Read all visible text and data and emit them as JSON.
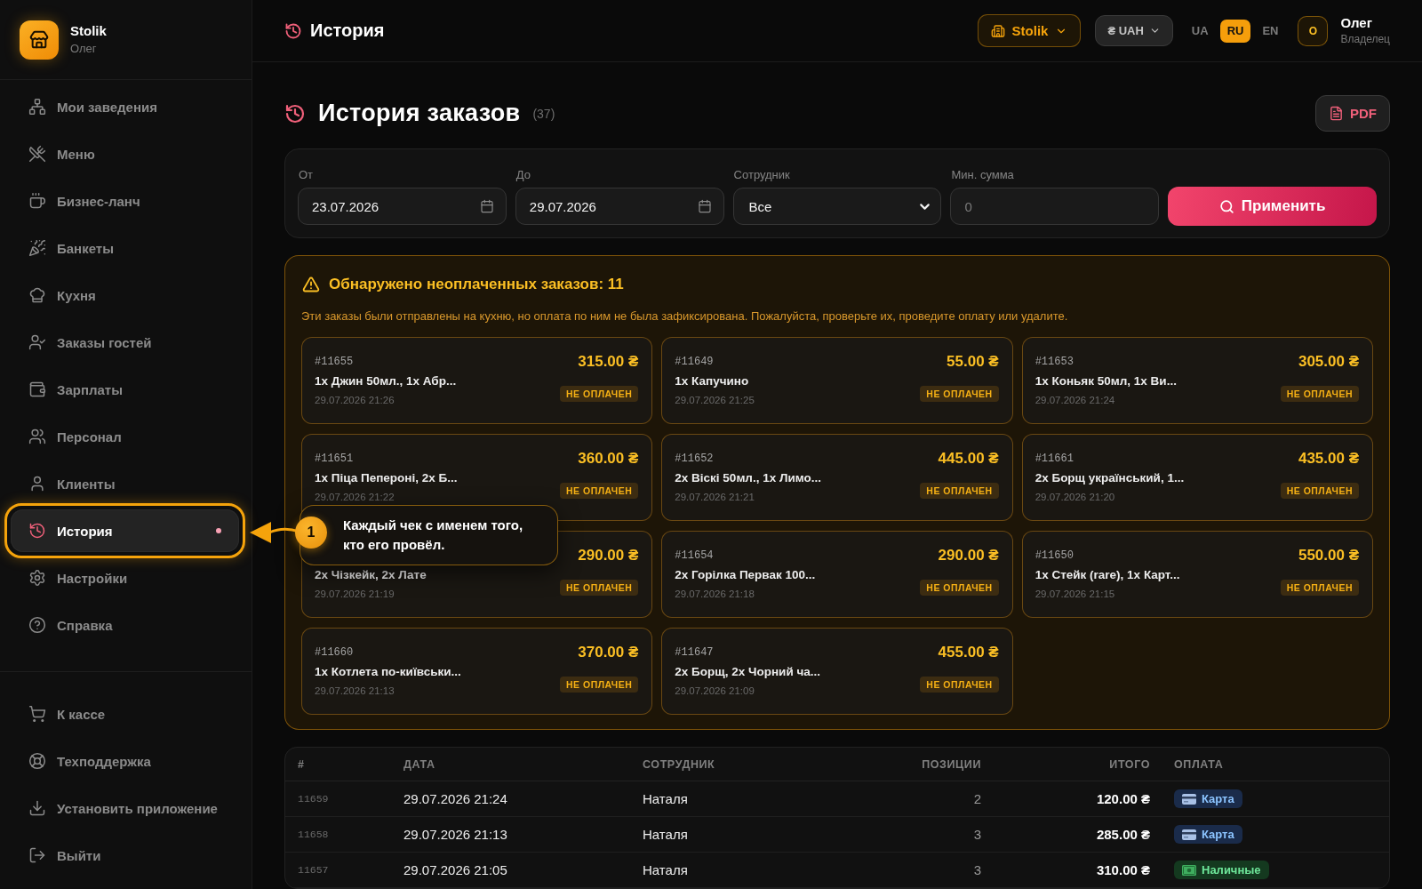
{
  "sidebar": {
    "brand": {
      "name": "Stolik",
      "subtitle": "Олег"
    },
    "nav": [
      {
        "label": "Мои заведения",
        "selected": false,
        "highlighted": false
      },
      {
        "label": "Меню",
        "selected": false,
        "highlighted": false
      },
      {
        "label": "Бизнес-ланч",
        "selected": false,
        "highlighted": false
      },
      {
        "label": "Банкеты",
        "selected": false,
        "highlighted": false
      },
      {
        "label": "Кухня",
        "selected": false,
        "highlighted": false
      },
      {
        "label": "Заказы гостей",
        "selected": false,
        "highlighted": false
      },
      {
        "label": "Зарплаты",
        "selected": false,
        "highlighted": false
      },
      {
        "label": "Персонал",
        "selected": false,
        "highlighted": false
      },
      {
        "label": "Клиенты",
        "selected": false,
        "highlighted": false
      },
      {
        "label": "История",
        "selected": true,
        "highlighted": true
      },
      {
        "label": "Настройки",
        "selected": false,
        "highlighted": false
      },
      {
        "label": "Справка",
        "selected": false,
        "highlighted": false
      }
    ],
    "footer_nav": [
      {
        "label": "К кассе",
        "selected": false
      },
      {
        "label": "Техподдержка",
        "selected": false
      },
      {
        "label": "Установить приложение",
        "selected": false
      },
      {
        "label": "Выйти",
        "selected": false
      }
    ]
  },
  "topbar": {
    "title": "История",
    "venue": "Stolik",
    "currency": "₴ UAH",
    "languages": [
      {
        "label": "UA",
        "selected": false
      },
      {
        "label": "RU",
        "selected": true
      },
      {
        "label": "EN",
        "selected": false
      }
    ],
    "user": {
      "initial": "О",
      "name": "Олег",
      "role": "Владелец"
    }
  },
  "page": {
    "title": "История заказов",
    "count": "(37)",
    "export_button": "PDF"
  },
  "filters": {
    "from": {
      "label": "От",
      "value": "23.07.2026"
    },
    "to": {
      "label": "До",
      "value": "29.07.2026"
    },
    "employee": {
      "label": "Сотрудник",
      "value": "Все"
    },
    "min_sum": {
      "label": "Мин. сумма",
      "placeholder": "0"
    },
    "apply_button": "Применить"
  },
  "unpaid_alert": {
    "title": "Обнаружено неоплаченных заказов: 11",
    "description": "Эти заказы были отправлены на кухню, но оплата по ним не была зафиксирована. Пожалуйста, проверьте их, проведите оплату или удалите.",
    "orders": [
      {
        "id": "#11655",
        "items": "1x Джин 50мл., 1x Абр...",
        "date": "29.07.2026 21:26",
        "amount": "315.00 ₴",
        "status": "НЕ ОПЛАЧЕН"
      },
      {
        "id": "#11649",
        "items": "1x Капучино",
        "date": "29.07.2026 21:25",
        "amount": "55.00 ₴",
        "status": "НЕ ОПЛАЧЕН"
      },
      {
        "id": "#11653",
        "items": "1x Коньяк 50мл, 1x Ви...",
        "date": "29.07.2026 21:24",
        "amount": "305.00 ₴",
        "status": "НЕ ОПЛАЧЕН"
      },
      {
        "id": "#11651",
        "items": "1x Піца Пепероні, 2x Б...",
        "date": "29.07.2026 21:22",
        "amount": "360.00 ₴",
        "status": "НЕ ОПЛАЧЕН"
      },
      {
        "id": "#11652",
        "items": "2x Віскі 50мл., 1x Лимо...",
        "date": "29.07.2026 21:21",
        "amount": "445.00 ₴",
        "status": "НЕ ОПЛАЧЕН"
      },
      {
        "id": "#11661",
        "items": "2x Борщ український, 1...",
        "date": "29.07.2026 21:20",
        "amount": "435.00 ₴",
        "status": "НЕ ОПЛАЧЕН"
      },
      {
        "items": "2x Чізкейк, 2x Лате",
        "date": "29.07.2026 21:19",
        "amount": "290.00 ₴",
        "status": "НЕ ОПЛАЧЕН"
      },
      {
        "id": "#11654",
        "items": "2x Горілка Первак 100...",
        "date": "29.07.2026 21:18",
        "amount": "290.00 ₴",
        "status": "НЕ ОПЛАЧЕН"
      },
      {
        "id": "#11650",
        "items": "1x Стейк (rare), 1x Карт...",
        "date": "29.07.2026 21:15",
        "amount": "550.00 ₴",
        "status": "НЕ ОПЛАЧЕН"
      },
      {
        "id": "#11660",
        "items": "1x Котлета по-київськи...",
        "date": "29.07.2026 21:13",
        "amount": "370.00 ₴",
        "status": "НЕ ОПЛАЧЕН"
      },
      {
        "id": "#11647",
        "items": "2x Борщ, 2x Чорний ча...",
        "date": "29.07.2026 21:09",
        "amount": "455.00 ₴",
        "status": "НЕ ОПЛАЧЕН"
      }
    ]
  },
  "orders_table": {
    "columns": [
      "#",
      "ДАТА",
      "СОТРУДНИК",
      "ПОЗИЦИИ",
      "ИТОГО",
      "ОПЛАТА"
    ],
    "rows": [
      {
        "id": "11659",
        "date": "29.07.2026 21:24",
        "employee": "Наталя",
        "positions": "2",
        "total": "120.00 ₴",
        "payment": {
          "kind": "card",
          "label": "Карта"
        }
      },
      {
        "id": "11658",
        "date": "29.07.2026 21:13",
        "employee": "Наталя",
        "positions": "3",
        "total": "285.00 ₴",
        "payment": {
          "kind": "card",
          "label": "Карта"
        }
      },
      {
        "id": "11657",
        "date": "29.07.2026 21:05",
        "employee": "Наталя",
        "positions": "3",
        "total": "310.00 ₴",
        "payment": {
          "kind": "cash",
          "label": "Наличные"
        }
      }
    ]
  },
  "tour": {
    "step": "1",
    "text": "Каждый чек с именем того, кто его провёл."
  }
}
